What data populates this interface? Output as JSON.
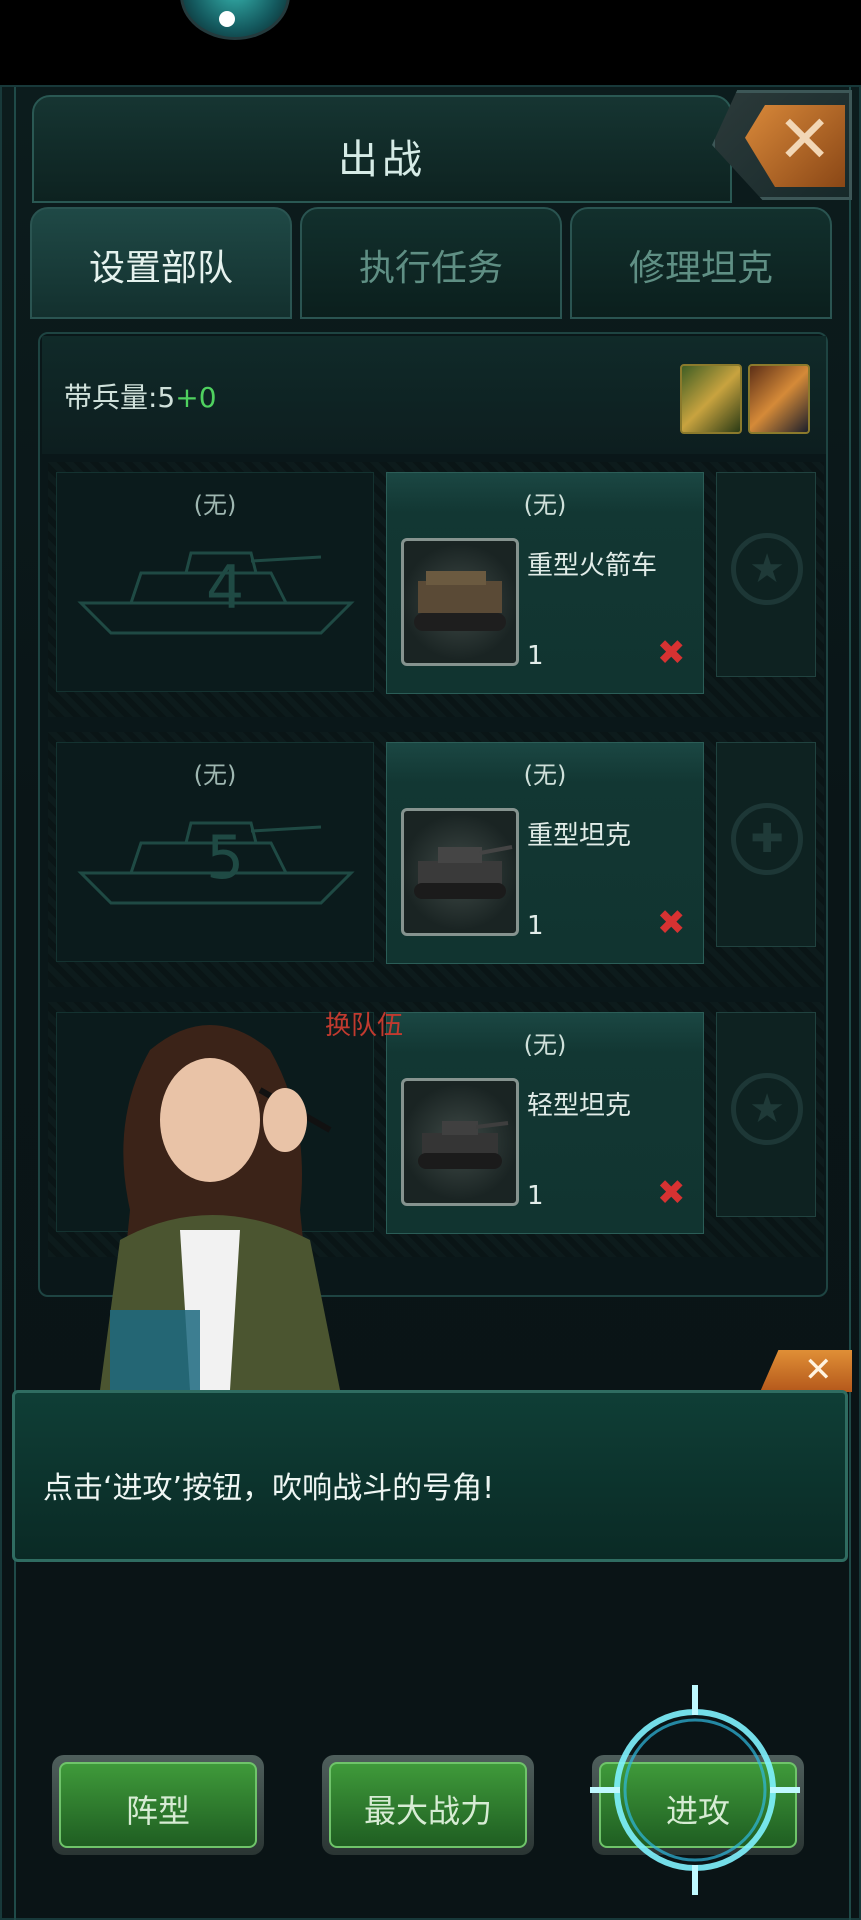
{
  "window": {
    "title": "出战"
  },
  "tabs": [
    {
      "label": "设置部队",
      "active": true
    },
    {
      "label": "执行任务",
      "active": false
    },
    {
      "label": "修理坦克",
      "active": false
    }
  ],
  "capacity": {
    "label": "带兵量:5",
    "bonus": "+0"
  },
  "rows": [
    {
      "left_label": "(无)",
      "slot_number": "4",
      "mid_label": "(无)",
      "unit_name": "重型火箭车",
      "unit_count": "1"
    },
    {
      "left_label": "(无)",
      "slot_number": "5",
      "mid_label": "(无)",
      "unit_name": "重型坦克",
      "unit_count": "1"
    },
    {
      "left_label": "",
      "slot_number": "",
      "mid_label": "(无)",
      "unit_name": "轻型坦克",
      "unit_count": "1"
    }
  ],
  "swap_text": "换队伍",
  "tip": {
    "text": "点击‘进攻’按钮，吹响战斗的号角!"
  },
  "buttons": {
    "formation": "阵型",
    "max_power": "最大战力",
    "attack": "进攻"
  },
  "colors": {
    "accent_green": "#3f9a3a",
    "close_orange": "#d9893a",
    "remove_red": "#d63232",
    "bonus_green": "#4fd15f"
  }
}
